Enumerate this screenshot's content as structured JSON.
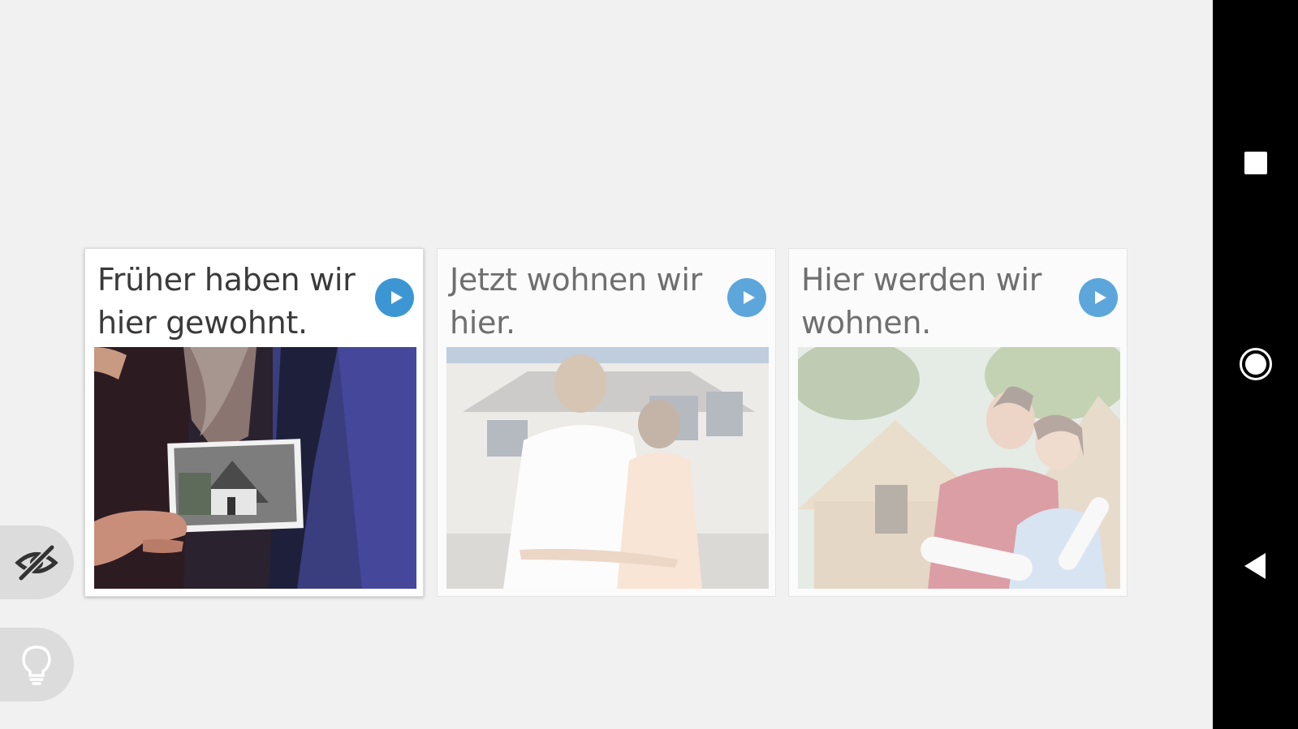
{
  "cards": [
    {
      "title": "Früher haben wir hier gewohnt.",
      "image": "old-house-photo-held-in-hand",
      "state": "selected",
      "play_icon": "play-icon"
    },
    {
      "title": "Jetzt wohnen wir hier.",
      "image": "couple-looking-at-house",
      "state": "dimmed",
      "play_icon": "play-icon"
    },
    {
      "title": "Hier werden wir wohnen.",
      "image": "couple-with-plans-at-new-house",
      "state": "dimmed",
      "play_icon": "play-icon"
    }
  ],
  "side_buttons": [
    {
      "icon": "eye-slash-icon"
    },
    {
      "icon": "lightbulb-icon"
    }
  ],
  "system_nav": {
    "buttons": [
      "recents-icon",
      "home-icon",
      "back-icon"
    ]
  },
  "colors": {
    "play": "#3d96d4",
    "background": "#f1f1f1",
    "side_button": "#dcdcdc",
    "navbar": "#000000"
  }
}
